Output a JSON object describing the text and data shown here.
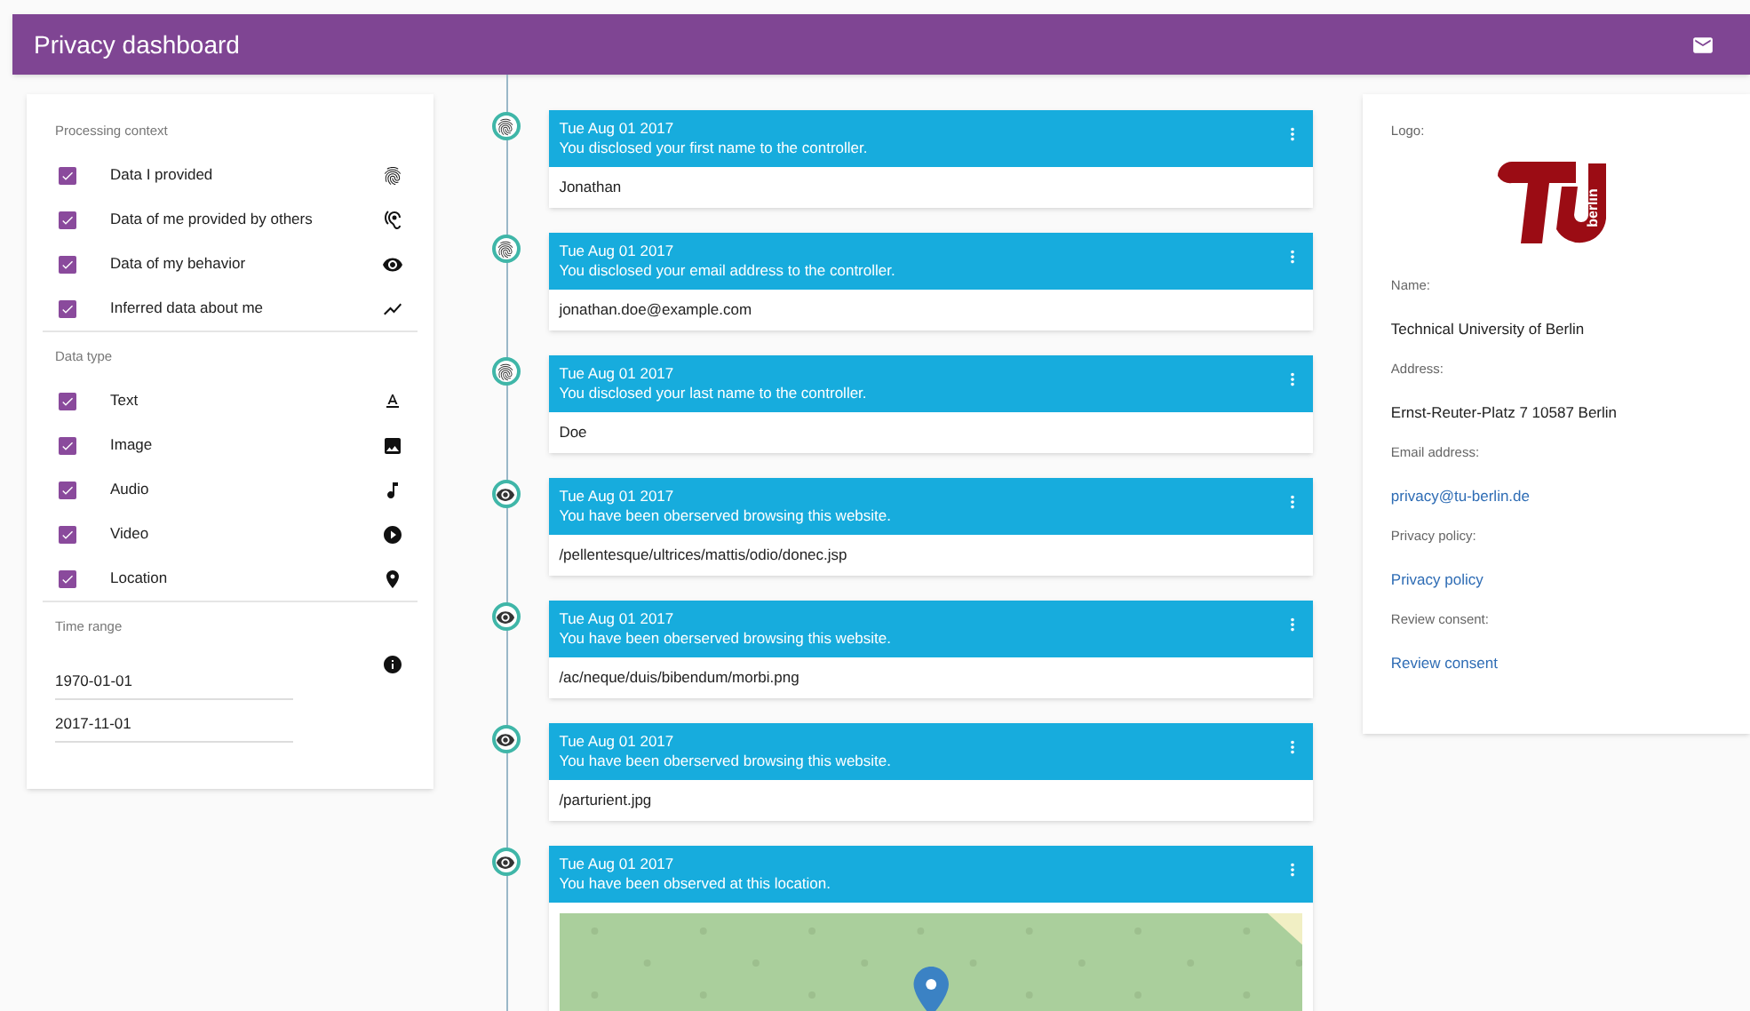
{
  "header": {
    "title": "Privacy dashboard"
  },
  "filters": {
    "sections": [
      {
        "title": "Processing context",
        "items": [
          {
            "label": "Data I provided",
            "checked": true
          },
          {
            "label": "Data of me provided by others",
            "checked": true
          },
          {
            "label": "Data of my behavior",
            "checked": true
          },
          {
            "label": "Inferred data about me",
            "checked": true
          }
        ]
      },
      {
        "title": "Data type",
        "items": [
          {
            "label": "Text",
            "checked": true
          },
          {
            "label": "Image",
            "checked": true
          },
          {
            "label": "Audio",
            "checked": true
          },
          {
            "label": "Video",
            "checked": true
          },
          {
            "label": "Location",
            "checked": true
          }
        ]
      }
    ],
    "time_range": {
      "title": "Time range",
      "from": "1970-01-01",
      "to": "2017-11-01"
    }
  },
  "timeline": [
    {
      "kind": "disclosed",
      "date": "Tue Aug 01 2017",
      "text": "You disclosed your first name to the controller.",
      "value": "Jonathan"
    },
    {
      "kind": "disclosed",
      "date": "Tue Aug 01 2017",
      "text": "You disclosed your email address to the controller.",
      "value": "jonathan.doe@example.com"
    },
    {
      "kind": "disclosed",
      "date": "Tue Aug 01 2017",
      "text": "You disclosed your last name to the controller.",
      "value": "Doe"
    },
    {
      "kind": "observed",
      "date": "Tue Aug 01 2017",
      "text": "You have been oberserved browsing this website.",
      "value": "/pellentesque/ultrices/mattis/odio/donec.jsp"
    },
    {
      "kind": "observed",
      "date": "Tue Aug 01 2017",
      "text": "You have been oberserved browsing this website.",
      "value": "/ac/neque/duis/bibendum/morbi.png"
    },
    {
      "kind": "observed",
      "date": "Tue Aug 01 2017",
      "text": "You have been oberserved browsing this website.",
      "value": "/parturient.jpg"
    },
    {
      "kind": "location",
      "date": "Tue Aug 01 2017",
      "text": "You have been observed at this location."
    }
  ],
  "controller": {
    "logo_label": "Logo:",
    "logo_text": "berlin",
    "fields": [
      {
        "label": "Name:",
        "value": "Technical University of Berlin",
        "kind": "text"
      },
      {
        "label": "Address:",
        "value": "Ernst-Reuter-Platz 7 10587 Berlin",
        "kind": "text"
      },
      {
        "label": "Email address:",
        "value": "privacy@tu-berlin.de",
        "kind": "link"
      },
      {
        "label": "Privacy policy:",
        "value": "Privacy policy",
        "kind": "link"
      },
      {
        "label": "Review consent:",
        "value": "Review consent",
        "kind": "link"
      }
    ]
  }
}
